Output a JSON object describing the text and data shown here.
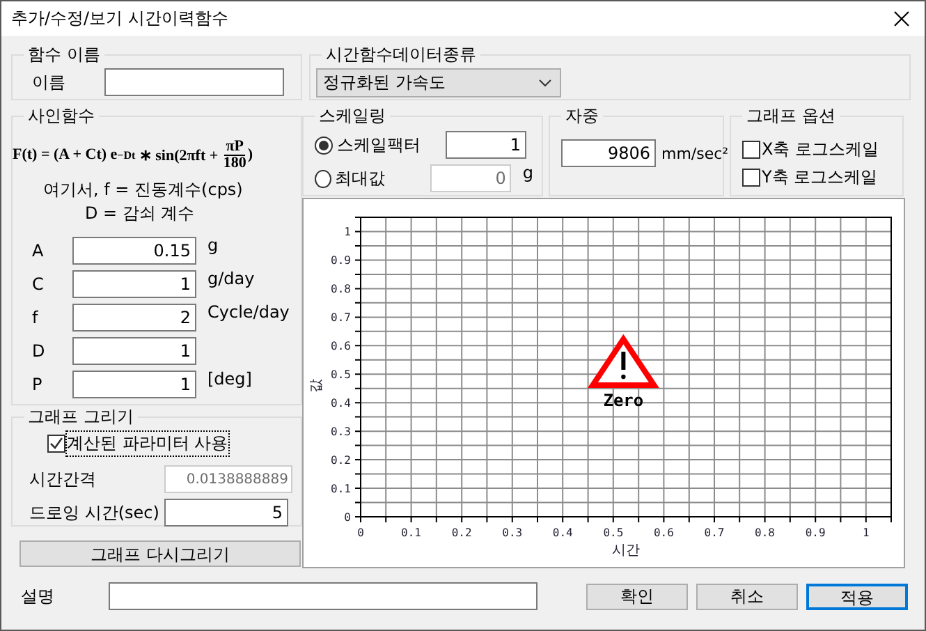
{
  "window": {
    "title": "추가/수정/보기 시간이력함수"
  },
  "name_group": {
    "title": "함수 이름",
    "label": "이름"
  },
  "sine_function": {
    "title": "사인함수",
    "formula": {
      "lhs": "F(t) = (A + Ct) e",
      "exponent": "−Dt",
      "rhs": "∗ sin(2πft +",
      "numerator": "πP",
      "denominator": "180",
      "close": ")"
    },
    "notes": [
      "여기서, f = 진동계수(cps)",
      "D = 감쇠 계수"
    ],
    "params": [
      {
        "label": "A",
        "value": "0.15",
        "unit": "g"
      },
      {
        "label": "C",
        "value": "1",
        "unit": "g/day"
      },
      {
        "label": "f",
        "value": "2",
        "unit": "Cycle/day"
      },
      {
        "label": "D",
        "value": "1"
      },
      {
        "label": "P",
        "value": "1",
        "unit": "[deg]"
      }
    ]
  },
  "graph_drawing": {
    "title": "그래프 그리기",
    "use_calculated": {
      "label": "계산된 파라미터 사용",
      "checked": true
    },
    "interval": {
      "label": "시간간격",
      "value": "0.0138888889",
      "disabled": true
    },
    "duration": {
      "label": "드로잉 시간(sec)",
      "value": "5",
      "disabled": false
    }
  },
  "redraw_button": "그래프 다시그리기",
  "data_type": {
    "title": "시간함수데이터종류",
    "value": "정규화된 가속도"
  },
  "scaling": {
    "title": "스케일링",
    "options": [
      {
        "label": "스케일팩터",
        "selected": true,
        "value": "1",
        "disabled": false
      },
      {
        "label": "최대값",
        "selected": false,
        "value": "0",
        "unit": "g",
        "disabled": true
      }
    ]
  },
  "self_weight": {
    "title": "자중",
    "value": "9806",
    "unit": "mm/sec²"
  },
  "graph_options": {
    "title": "그래프 옵션",
    "options": [
      {
        "label": "X축 로그스케일",
        "checked": false
      },
      {
        "label": "Y축 로그스케일",
        "checked": false
      }
    ]
  },
  "chart": {
    "warning": "Zero",
    "chart_data": {
      "type": "line",
      "grid": true,
      "xlabel": "시간",
      "ylabel": "값",
      "xlim": [
        0,
        1.05
      ],
      "ylim": [
        0,
        1.05
      ],
      "xticks": [
        0,
        0.1,
        0.2,
        0.3,
        0.4,
        0.5,
        0.6,
        0.7,
        0.8,
        0.9,
        1
      ],
      "yticks": [
        0,
        0.1,
        0.2,
        0.3,
        0.4,
        0.5,
        0.6,
        0.7,
        0.8,
        0.9,
        1
      ]
    }
  },
  "description": {
    "label": "설명"
  },
  "buttons": [
    {
      "label": "확인",
      "focused": false
    },
    {
      "label": "취소",
      "focused": false
    },
    {
      "label": "적용",
      "focused": true
    }
  ]
}
